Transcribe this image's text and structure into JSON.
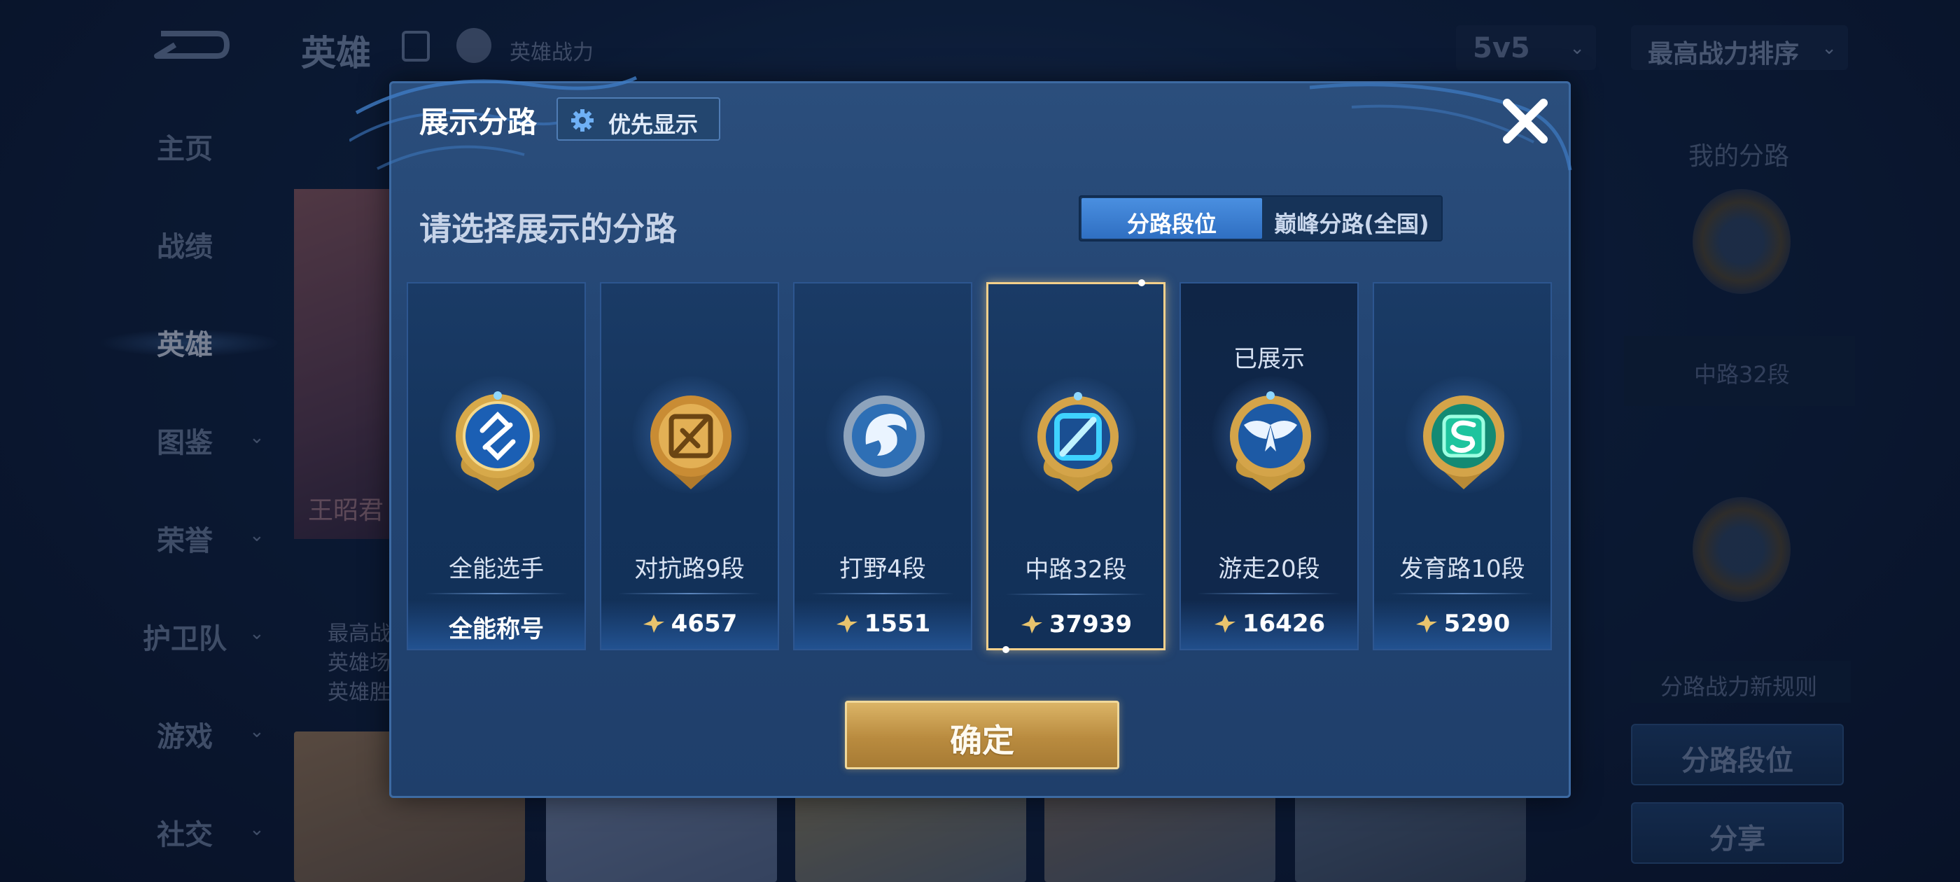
{
  "topbar": {
    "title": "英雄",
    "power_label": "英雄战力",
    "mode": "5v5",
    "sort": "最高战力排序"
  },
  "nav": {
    "items": [
      {
        "label": "主页",
        "caret": false
      },
      {
        "label": "战绩",
        "caret": false
      },
      {
        "label": "英雄",
        "caret": false,
        "active": true
      },
      {
        "label": "图鉴",
        "caret": true
      },
      {
        "label": "荣誉",
        "caret": true
      },
      {
        "label": "护卫队",
        "caret": true
      },
      {
        "label": "游戏",
        "caret": true
      },
      {
        "label": "社交",
        "caret": true
      }
    ]
  },
  "hero": {
    "name": "王昭君",
    "stats": [
      "最高战",
      "英雄场",
      "英雄胜"
    ]
  },
  "right_panel": {
    "title": "我的分路",
    "lane_label": "中路32段",
    "rule_label": "分路战力新规则",
    "lane_rank_button": "分路段位",
    "share_button": "分享"
  },
  "modal": {
    "title": "展示分路",
    "priority_button": "优先显示",
    "subtitle": "请选择展示的分路",
    "tabs": [
      "分路段位",
      "巅峰分路(全国)"
    ],
    "confirm": "确定",
    "cards": [
      {
        "name": "全能选手",
        "value": "全能称号",
        "has_power": false,
        "note": "",
        "selected": false,
        "displayed": false,
        "badge": "all-round-badge-icon"
      },
      {
        "name": "对抗路9段",
        "value": "4657",
        "has_power": true,
        "note": "",
        "selected": false,
        "displayed": false,
        "badge": "clash-lane-badge-icon"
      },
      {
        "name": "打野4段",
        "value": "1551",
        "has_power": true,
        "note": "",
        "selected": false,
        "displayed": false,
        "badge": "jungle-badge-icon"
      },
      {
        "name": "中路32段",
        "value": "37939",
        "has_power": true,
        "note": "",
        "selected": true,
        "displayed": false,
        "badge": "mid-lane-badge-icon"
      },
      {
        "name": "游走20段",
        "value": "16426",
        "has_power": true,
        "note": "已展示",
        "selected": false,
        "displayed": true,
        "badge": "roam-badge-icon"
      },
      {
        "name": "发育路10段",
        "value": "5290",
        "has_power": true,
        "note": "",
        "selected": false,
        "displayed": false,
        "badge": "farm-lane-badge-icon"
      }
    ]
  },
  "colors": {
    "accent_blue": "#3a7fd6",
    "selected_gold": "#f3d08b",
    "confirm_gold": "#c99a4e"
  }
}
